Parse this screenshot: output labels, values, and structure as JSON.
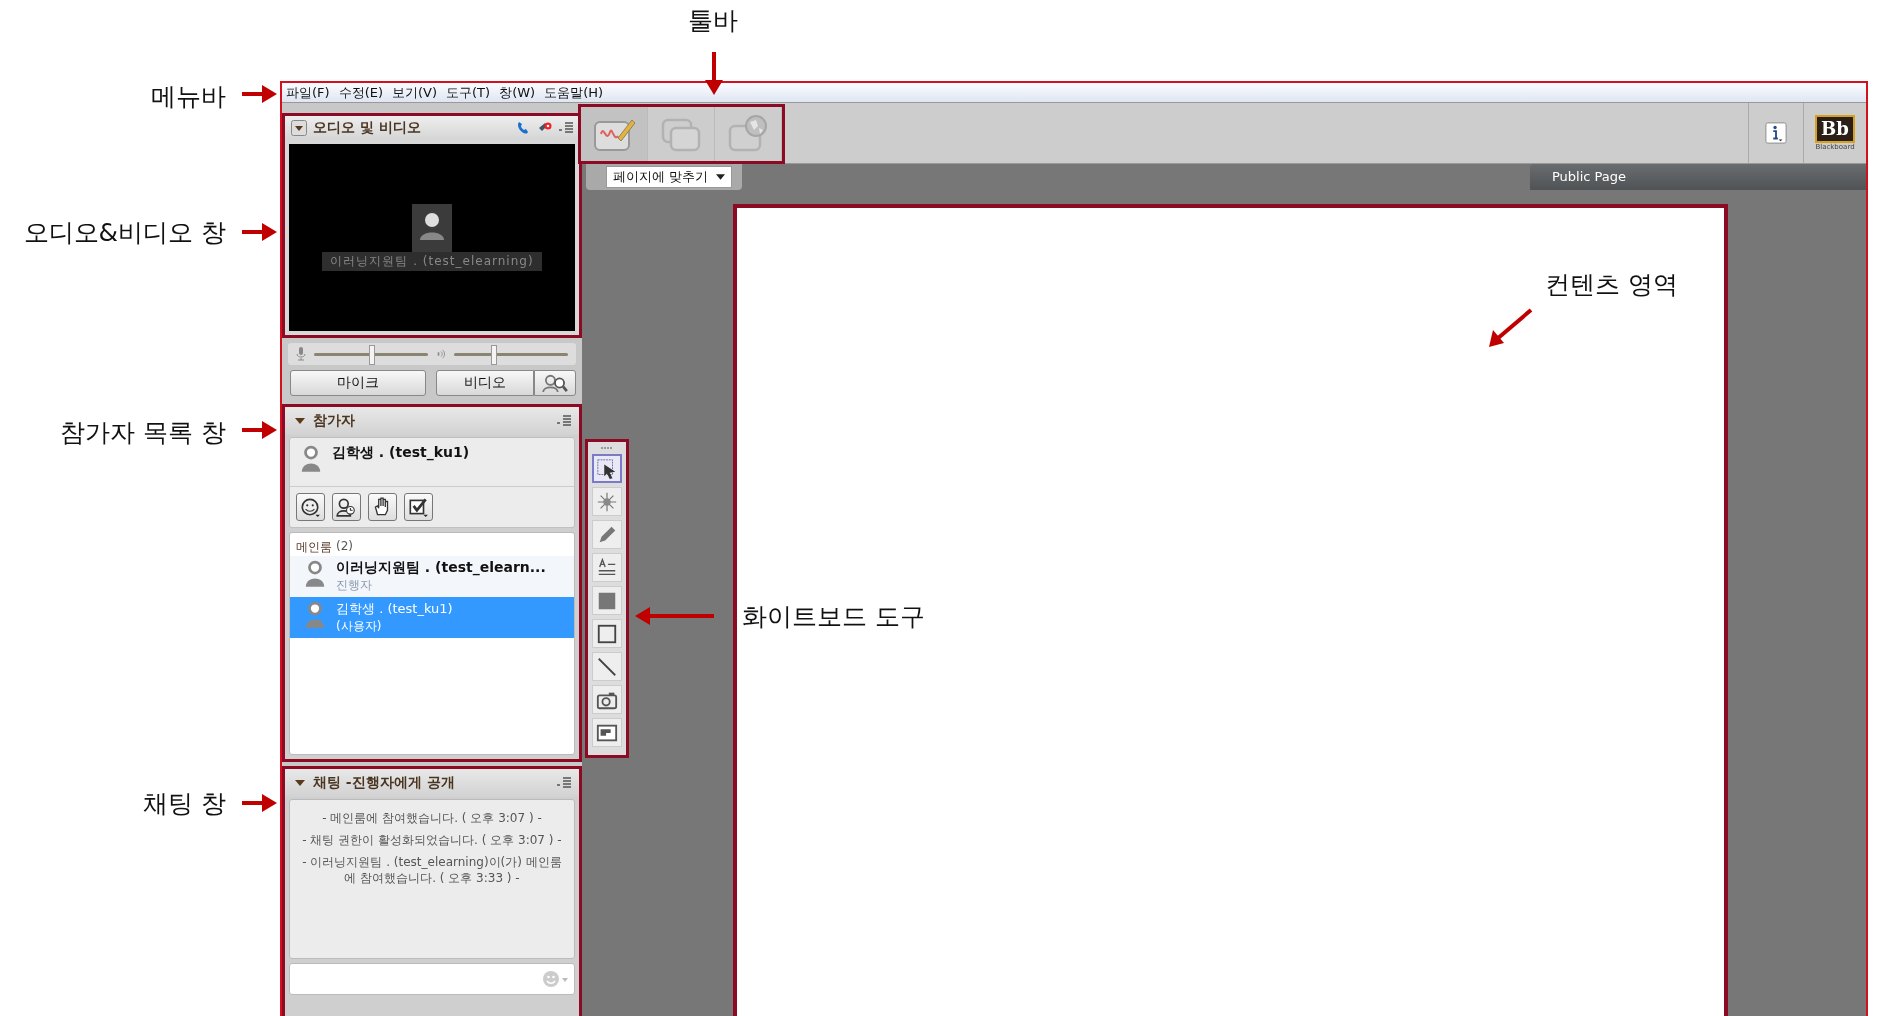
{
  "annotations": [
    {
      "kind": "left",
      "label": "메뉴바"
    },
    {
      "kind": "left",
      "label": "오디오&비디오 창"
    },
    {
      "kind": "left",
      "label": "참가자 목록 창"
    },
    {
      "kind": "left",
      "label": "채팅 창"
    },
    {
      "kind": "down",
      "label": "툴바"
    },
    {
      "kind": "right",
      "label": "화이트보드 도구"
    },
    {
      "kind": "diagonal",
      "label": "컨텐츠 영역"
    }
  ],
  "menu": [
    "파일(F)",
    "수정(E)",
    "보기(V)",
    "도구(T)",
    "창(W)",
    "도움말(H)"
  ],
  "audio_video": {
    "title": "오디오 및 비디오",
    "video_caption": "이러닝지원팀 . (test_elearning)",
    "mic_slider": {
      "level": 0.5
    },
    "speaker_slider": {
      "level": 0.34
    },
    "buttons": [
      "마이크",
      "비디오"
    ]
  },
  "participants": {
    "title": "참가자",
    "me": {
      "name": "김학생 . (test_ku1)"
    },
    "room": {
      "name": "메인룸",
      "count": "(2)"
    },
    "members": [
      {
        "name": "이러닝지원팀 . (test_elearn...",
        "role": "진행자",
        "kind": "presenter",
        "selected": false
      },
      {
        "name": "김학생 . (test_ku1)",
        "role": "(사용자)",
        "kind": "user",
        "selected": true
      }
    ]
  },
  "chat": {
    "title": "채팅 -진행자에게 공개",
    "messages": [
      "- 메인룸에 참여했습니다. ( 오후 3:07 ) -",
      "- 채팅 권한이 활성화되었습니다. ( 오후 3:07 ) -",
      "- 이러닝지원팀 . (test_elearning)이(가) 메인룸에 참여했습니다. ( 오후 3:33 ) -"
    ]
  },
  "toolbar": [
    {
      "kind": "whiteboard",
      "selected": true
    },
    {
      "kind": "windows",
      "selected": false
    },
    {
      "kind": "globe",
      "selected": false
    }
  ],
  "view": {
    "zoom": "페이지에 맞추기",
    "page_tab": "Public Page"
  },
  "logo": {
    "mark": "Bb",
    "caption": "Blackboard"
  },
  "whiteboard_tools": [
    {
      "kind": "select",
      "selected": true
    },
    {
      "kind": "pointer",
      "selected": false
    },
    {
      "kind": "pencil",
      "selected": false
    },
    {
      "kind": "text",
      "selected": false
    },
    {
      "kind": "filled-rect",
      "selected": false
    },
    {
      "kind": "rect",
      "selected": false
    },
    {
      "kind": "line",
      "selected": false
    },
    {
      "kind": "camera",
      "selected": false
    },
    {
      "kind": "image",
      "selected": false
    }
  ]
}
